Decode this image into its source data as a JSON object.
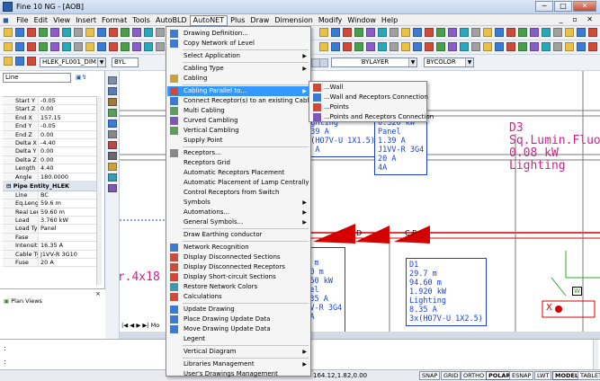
{
  "window": {
    "title": "Fine 10 NG - [AOB]",
    "min": "─",
    "max": "□",
    "close": "✕"
  },
  "menubar": [
    "File",
    "Edit",
    "View",
    "Insert",
    "Format",
    "Tools",
    "AutoBLD",
    "AutoNET",
    "Plus",
    "Draw",
    "Dimension",
    "Modify",
    "Window",
    "Help"
  ],
  "mdi_controls": "_ ▫ ✕",
  "toolbar": {
    "layer_combo": "HLEK_FL001_DIM",
    "color_combo": "BYL",
    "linetype_combo": "BYLAYER",
    "color2_combo": "BYCOLOR"
  },
  "left_panel": {
    "filter_combo": "Line",
    "properties": [
      {
        "k": "Start Y",
        "v": "-0.05"
      },
      {
        "k": "Start Z",
        "v": "0.00"
      },
      {
        "k": "End X",
        "v": "157.15"
      },
      {
        "k": "End Y",
        "v": "-0.05"
      },
      {
        "k": "End Z",
        "v": "0.00"
      },
      {
        "k": "Delta X",
        "v": "-4.40"
      },
      {
        "k": "Delta Y",
        "v": "0.00"
      },
      {
        "k": "Delta Z",
        "v": "0.00"
      },
      {
        "k": "Length",
        "v": "4.40"
      },
      {
        "k": "Angle",
        "v": "180.0000"
      }
    ],
    "group_title": "Pipe Entity_HLEK",
    "group_props": [
      {
        "k": "Line",
        "v": "BC"
      },
      {
        "k": "Eq.Length",
        "v": "59.6 m"
      },
      {
        "k": "Real Length",
        "v": "59.60 m"
      },
      {
        "k": "Load",
        "v": "3.760 kW"
      },
      {
        "k": "Load Type",
        "v": "Panel"
      },
      {
        "k": "Fase",
        "v": ""
      },
      {
        "k": "Intensity",
        "v": "16.35 A"
      },
      {
        "k": "Cable Type",
        "v": "J1VV-R 3G10"
      },
      {
        "k": "Fuse",
        "v": "20 A"
      }
    ],
    "tree_item": "Plan Views"
  },
  "menu": {
    "items": [
      {
        "label": "Drawing Definition...",
        "sub": false
      },
      {
        "label": "Copy Network of Level",
        "sub": false
      },
      {
        "label": "Select Application",
        "sub": true
      },
      {
        "label": "Cabling Type",
        "sub": true
      },
      {
        "label": "Cabling",
        "sub": false
      },
      {
        "label": "Cabling Parallel to...",
        "sub": true
      },
      {
        "label": "Connect Receptor(s) to an existing Cable",
        "sub": false
      },
      {
        "label": "Multi Cabling",
        "sub": false
      },
      {
        "label": "Curved Cambling",
        "sub": false
      },
      {
        "label": "Vertical Cambling",
        "sub": false
      },
      {
        "label": "Supply Point",
        "sub": false
      },
      {
        "label": "Receptors...",
        "sub": false
      },
      {
        "label": "Receptors Grid",
        "sub": false
      },
      {
        "label": "Automatic Receptors Placement",
        "sub": false
      },
      {
        "label": "Automatic Placement of Lamp Centrally",
        "sub": false
      },
      {
        "label": "Control Receptors from Switch",
        "sub": false
      },
      {
        "label": "Symbols",
        "sub": true
      },
      {
        "label": "Automations...",
        "sub": true
      },
      {
        "label": "General Symbols...",
        "sub": true
      },
      {
        "label": "Draw Earthing conductor",
        "sub": false
      },
      {
        "label": "Network Recognition",
        "sub": false
      },
      {
        "label": "Display Disconnected Sections",
        "sub": false
      },
      {
        "label": "Display Disconnected Receptors",
        "sub": false
      },
      {
        "label": "Display Short-circuit Sections",
        "sub": false
      },
      {
        "label": "Restore Network Colors",
        "sub": false
      },
      {
        "label": "Calculations",
        "sub": false
      },
      {
        "label": "Update Drawing",
        "sub": false
      },
      {
        "label": "Place Drawing Update Data",
        "sub": false
      },
      {
        "label": "Move Drawing Update Data",
        "sub": false
      },
      {
        "label": "Legent",
        "sub": false
      },
      {
        "label": "Vertical Diagram",
        "sub": true
      },
      {
        "label": "Libraries Management",
        "sub": true
      },
      {
        "label": "User's Drawings Management",
        "sub": false
      }
    ],
    "submenu": [
      "...Wall",
      "...Wall and Receptors Connection",
      "...Points",
      "...Points and Receptors Connection"
    ]
  },
  "canvas": {
    "block_left": "34.20 m\n0.320 kW\nLighting\n1.39 A\n3x(HO7V-U 1X1.5)\n10 A",
    "block_de": "DE\n23.5 m\n23.50 m\n0.320 kW\nPanel\n1.39 A\nJ1VV-R 3G4\n20 A\n4A",
    "block_d3": "D3\nSq.Lumin.Fluo\n0.08 kW\nLighting",
    "block_cd": "CD\n1.0 m\n1.00 m\n3.760 kW\nPanel\n16.35 A\nJ1VV-R 3G4\n20 A\n40A",
    "block_d1": "D1\n29.7 m\n94.60 m\n1.920 kW\nLighting\n8.35 A\n3x(HO7V-U 1X2.5)",
    "side_text": "or.4x18",
    "label_d": "D",
    "label_cp": "C.P",
    "label_w": "W",
    "label_x": "X",
    "model_tab": "Mo"
  },
  "command": {
    "line1": ":",
    "line2": ":"
  },
  "status": {
    "coords": "164.12,1.82,0.00",
    "buttons": [
      {
        "label": "SNAP",
        "on": false
      },
      {
        "label": "GRID",
        "on": false
      },
      {
        "label": "ORTHO",
        "on": false
      },
      {
        "label": "POLAR",
        "on": true
      },
      {
        "label": "ESNAP",
        "on": false
      },
      {
        "label": "LWT",
        "on": false
      },
      {
        "label": "MODEL",
        "on": true
      },
      {
        "label": "TABLET",
        "on": false
      },
      {
        "label": "DYN",
        "on": true
      }
    ]
  },
  "colors": {
    "accent": "#3399ff",
    "cad_blue": "#1a3fd9",
    "cad_magenta": "#d0208a",
    "cad_red": "#d40000"
  }
}
